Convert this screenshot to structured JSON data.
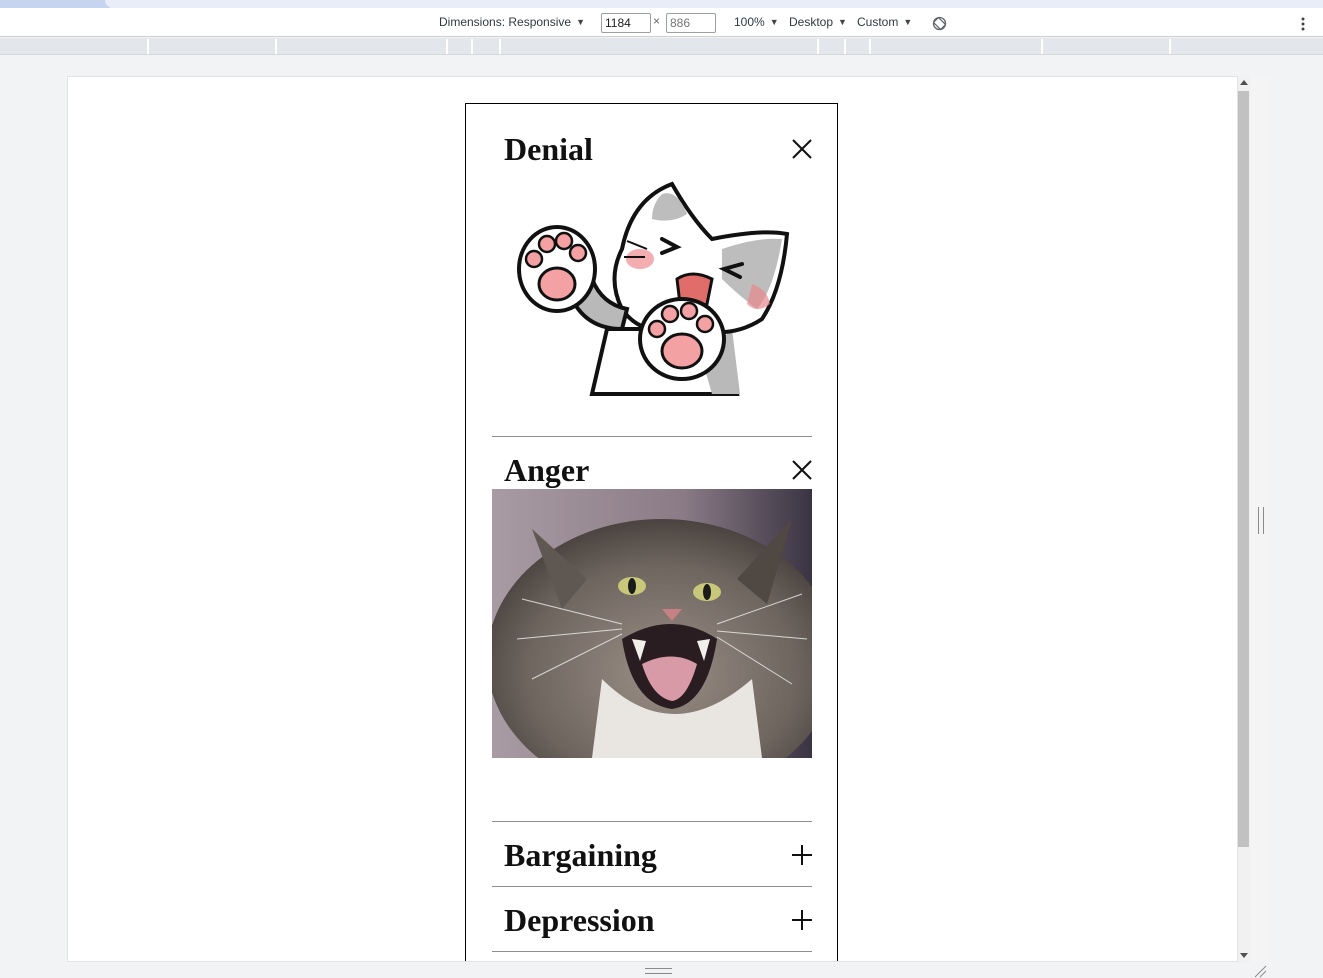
{
  "device_toolbar": {
    "dimensions_label": "Dimensions: Responsive",
    "width_value": "1184",
    "height_placeholder": "886",
    "times_symbol": "×",
    "zoom_label": "100%",
    "device_type_label": "Desktop",
    "throttle_label": "Custom"
  },
  "icons": {
    "rotate": "rotate-icon",
    "more": "more-vert-icon",
    "close": "close-icon",
    "expand": "plus-icon"
  },
  "accordion": {
    "sections": [
      {
        "title": "Denial",
        "state": "expanded",
        "image_alt": "cartoon cat raising paws"
      },
      {
        "title": "Anger",
        "state": "expanded",
        "image_alt": "hissing tabby cat"
      },
      {
        "title": "Bargaining",
        "state": "collapsed"
      },
      {
        "title": "Depression",
        "state": "collapsed"
      }
    ]
  },
  "colors": {
    "toolbar_bg": "#ffffff",
    "page_bg": "#f1f3f4",
    "border": "#000000"
  }
}
